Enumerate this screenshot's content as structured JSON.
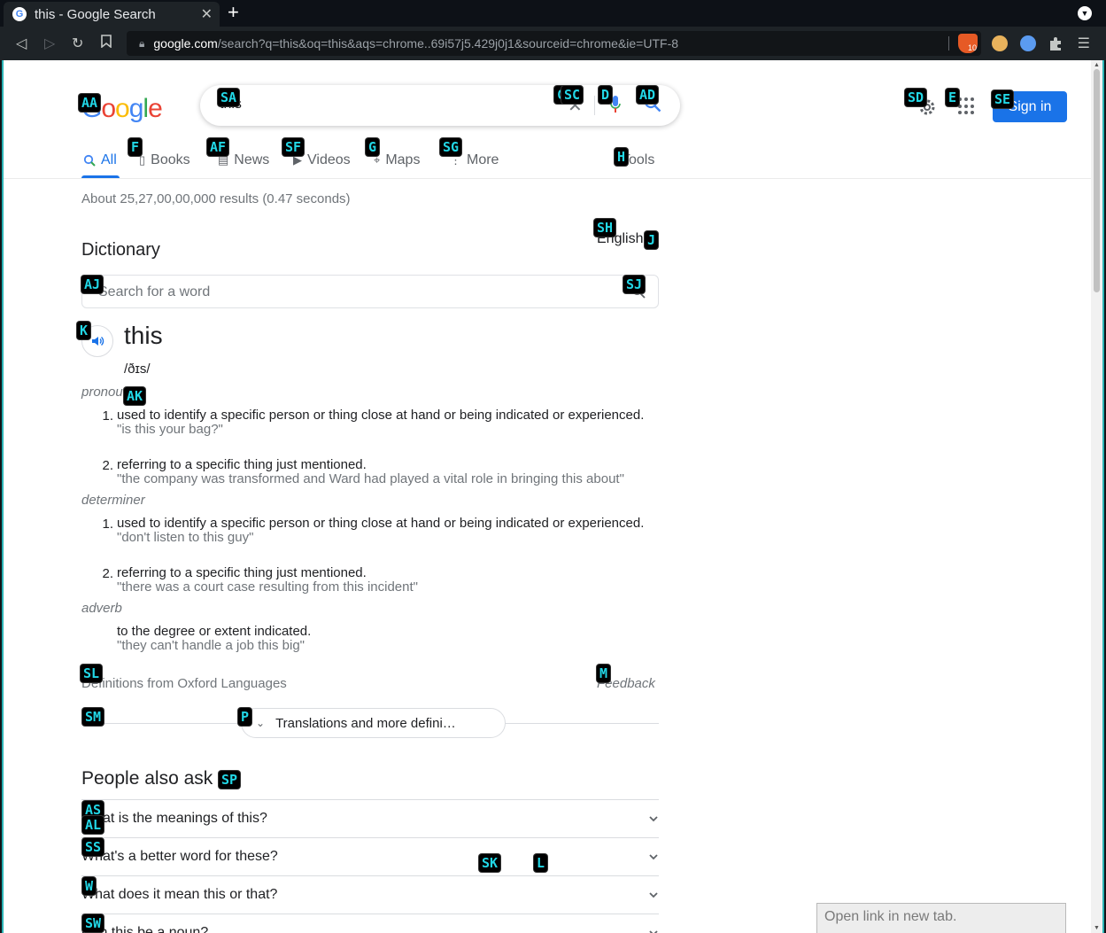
{
  "browser": {
    "tab_title": "this - Google Search",
    "tab_favicon": "G",
    "new_tab": "+",
    "url_host": "google.com",
    "url_path": "/search?q=this&oq=this&aqs=chrome..69i57j5.429j0j1&sourceid=chrome&ie=UTF-8",
    "brave_badge": "10"
  },
  "google": {
    "logo": [
      "G",
      "o",
      "o",
      "g",
      "l",
      "e"
    ],
    "query": "this",
    "signin": "Sign in",
    "tabs": [
      {
        "label": "All",
        "icon": "search-icon"
      },
      {
        "label": "Books",
        "icon": "book-icon"
      },
      {
        "label": "News",
        "icon": "news-icon"
      },
      {
        "label": "Videos",
        "icon": "video-icon"
      },
      {
        "label": "Maps",
        "icon": "map-pin-icon"
      },
      {
        "label": "More",
        "icon": "more-vert-icon"
      }
    ],
    "tools": "Tools",
    "result_stats": "About 25,27,00,00,000 results (0.47 seconds)"
  },
  "dictionary": {
    "heading": "Dictionary",
    "language": "English",
    "search_placeholder": "Search for a word",
    "word": "this",
    "phonetic": "/ðɪs/",
    "pronoun_label": "pronoun",
    "pronoun_defs": [
      {
        "num": "1.",
        "text": "used to identify a specific person or thing close at hand or being indicated or experienced.",
        "example": "\"is this your bag?\""
      },
      {
        "num": "2.",
        "text": "referring to a specific thing just mentioned.",
        "example": "\"the company was transformed and Ward had played a vital role in bringing this about\""
      }
    ],
    "determiner_label": "determiner",
    "determiner_defs": [
      {
        "num": "1.",
        "text": "used to identify a specific person or thing close at hand or being indicated or experienced.",
        "example": "\"don't listen to this guy\""
      },
      {
        "num": "2.",
        "text": "referring to a specific thing just mentioned.",
        "example": "\"there was a court case resulting from this incident\""
      }
    ],
    "adverb_label": "adverb",
    "adverb_def": {
      "text": "to the degree or extent indicated.",
      "example": "\"they can't handle a job this big\""
    },
    "source": "Definitions from Oxford Languages",
    "feedback": "Feedback",
    "translations_btn": "Translations and more defini…"
  },
  "paa": {
    "heading": "People also ask",
    "questions": [
      "What is the meanings of this?",
      "What's a better word for these?",
      "What does it mean this or that?",
      "Can this be a noun?"
    ]
  },
  "status_popup": "Open link in new tab.",
  "hints": [
    "AA",
    "SA",
    "C",
    "SC",
    "D",
    "AD",
    "SD",
    "E",
    "SE",
    "F",
    "AF",
    "SF",
    "G",
    "SG",
    "H",
    "SH",
    "J",
    "AJ",
    "SJ",
    "K",
    "AK",
    "SL",
    "M",
    "SM",
    "P",
    "SP",
    "AS",
    "AL",
    "SS",
    "SK",
    "L",
    "W",
    "SW"
  ],
  "colors": {
    "accent": "#1a73e8",
    "hint_text": "#22d7e6",
    "hint_bg": "#000000",
    "viewport_border": "#2ab3b5"
  }
}
